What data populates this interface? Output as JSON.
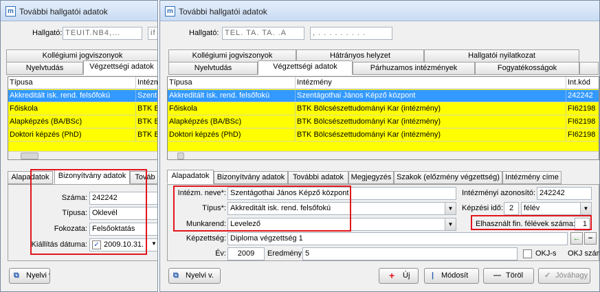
{
  "left_window": {
    "title": "További hallgatói adatok",
    "student_label": "Hallgató:",
    "student_value": "TEUIT.NB4,...",
    "student_value2": "if",
    "top_tabs": [
      "Kollégiumi jogviszonyok",
      "Nyelvtudás",
      "Végzettségi adatok"
    ],
    "grid": {
      "headers": [
        "Típusa",
        "Intézm"
      ],
      "rows": [
        [
          "Akkreditált isk. rend. felsőfokú",
          "Szent"
        ],
        [
          "Főiskola",
          "BTK B"
        ],
        [
          "Alapképzés (BA/BSc)",
          "BTK B"
        ],
        [
          "Doktori képzés (PhD)",
          "BTK B"
        ]
      ]
    },
    "sub_tabs": [
      "Alapadatok",
      "Bizonyítvány adatok",
      "Továb"
    ],
    "form": {
      "number_label": "Száma:",
      "number_value": "242242",
      "type_label": "Típusa:",
      "type_value": "Oklevél",
      "level_label": "Fokozata:",
      "level_value": "Felsőoktatás",
      "issue_date_label": "Kiállítás dátuma:",
      "issue_date_value": "2009.10.31."
    },
    "language_button": "Nyelvi v."
  },
  "right_window": {
    "title": "További hallgatói adatok",
    "student_label": "Hallgató:",
    "student_value": "TEL. TA. TA. .A",
    "student_value2": ", . . . . . . . . .",
    "top_tabs_row1": [
      "Kollégiumi jogviszonyok",
      "Hátrányos helyzet",
      "Hallgatói nyilatkozat"
    ],
    "top_tabs_row2": [
      "Nyelvtudás",
      "Végzettségi adatok",
      "Párhuzamos intézmények",
      "Fogyatékosságok"
    ],
    "grid": {
      "headers": [
        "Típusa",
        "Intézmény",
        "Int.kód"
      ],
      "rows": [
        [
          "Akkreditált isk. rend. felsőfokú",
          "Szentágothai János Képző központ",
          "242242"
        ],
        [
          "Főiskola",
          "BTK Bölcsészettudományi Kar (intézmény)",
          "FI62198"
        ],
        [
          "Alapképzés (BA/BSc)",
          "BTK Bölcsészettudományi Kar (intézmény)",
          "FI62198"
        ],
        [
          "Doktori képzés (PhD)",
          "BTK Bölcsészettudományi Kar (intézmény)",
          "FI62198"
        ]
      ]
    },
    "sub_tabs": [
      "Alapadatok",
      "Bizonyítvány adatok",
      "További adatok",
      "Megjegyzés",
      "Szakok (előzmény végzettség)",
      "Intézmény címe"
    ],
    "form": {
      "inst_name_label": "Intézm. neve*:",
      "inst_name_value": "Szentágothai János Képző központ",
      "inst_id_label": "Intézményi  azonosító:",
      "inst_id_value": "242242",
      "type_label": "Típus*:",
      "type_value": "Akkreditált isk. rend. felsőfokú",
      "training_time_label": "Képzési idő:",
      "training_time_value": "2",
      "training_time_unit": "félév",
      "schedule_label": "Munkarend:",
      "schedule_value": "Levelező",
      "used_semesters_label": "Elhasznált fin. félévek száma:",
      "used_semesters_value": "1",
      "qualification_label": "Képzettség:",
      "qualification_value": "Diploma végzettség 1",
      "year_label": "Év:",
      "year_value": "2009",
      "result_label": "Eredmény:",
      "result_value": "5",
      "okj_label": "OKJ-s",
      "okj_number_label": "OKJ szám:"
    },
    "buttons": {
      "language": "Nyelvi v.",
      "new": "Új",
      "modify": "Módosít",
      "delete": "Töröl",
      "approve": "Jóváhagy"
    }
  },
  "colors": {
    "highlight": "#e2141b",
    "selected_row": "#3399ff",
    "grid_row": "#ffff00"
  }
}
